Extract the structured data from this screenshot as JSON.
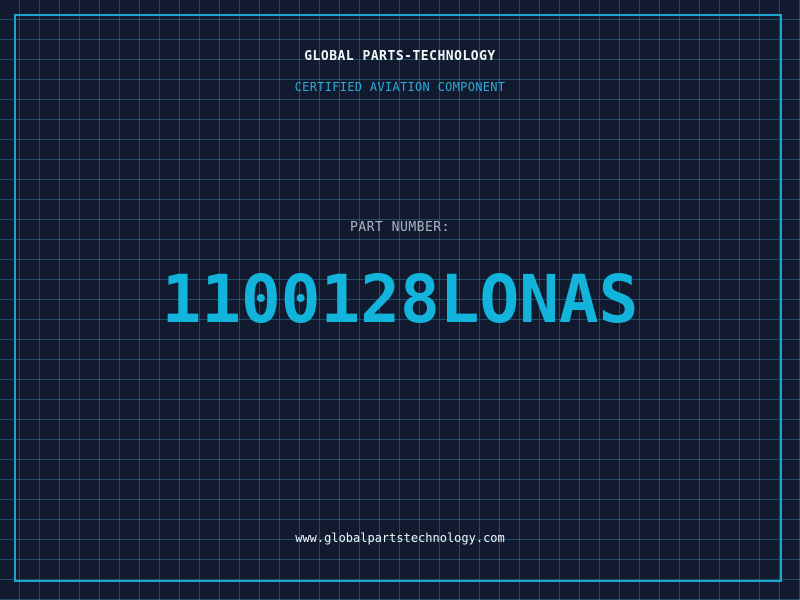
{
  "header": {
    "company": "GLOBAL PARTS-TECHNOLOGY",
    "subtitle": "CERTIFIED AVIATION COMPONENT"
  },
  "part": {
    "label": "PART NUMBER:",
    "number": "1100128LONAS"
  },
  "footer": {
    "website": "www.globalpartstechnology.com"
  },
  "colors": {
    "background": "#111a2f",
    "grid": "#28789a",
    "accent": "#12b4db",
    "text": "#f2f5f8"
  }
}
